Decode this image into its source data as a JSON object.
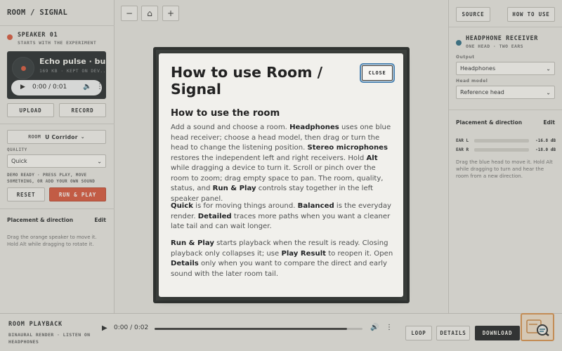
{
  "app_title": "ROOM / SIGNAL",
  "speaker": {
    "title": "SPEAKER 01",
    "subtitle": "STARTS WITH THE EXPERIMENT",
    "sound_name": "Echo pulse · bu...",
    "sound_meta": "169 KB · KEPT ON DEV...",
    "player_time": "0:00 / 0:01",
    "upload_label": "UPLOAD",
    "record_label": "RECORD"
  },
  "room": {
    "label": "ROOM",
    "value": "U Corridor"
  },
  "quality": {
    "label": "QUALITY",
    "value": "Quick"
  },
  "status_text": "DEMO READY · PRESS PLAY, MOVE SOMETHING, OR ADD YOUR OWN SOUND",
  "reset_label": "RESET",
  "run_label": "RUN & PLAY",
  "left_placement": {
    "title": "Placement & direction",
    "edit": "Edit",
    "help": "Drag the orange speaker to move it. Hold Alt while dragging to rotate it."
  },
  "toolbar": {
    "zoom_out": "−",
    "home": "⌂",
    "zoom_in": "+"
  },
  "top_right": {
    "source_label": "SOURCE",
    "howto_label": "HOW TO USE"
  },
  "receiver": {
    "title": "HEADPHONE RECEIVER",
    "subtitle": "ONE HEAD · TWO EARS",
    "output_label": "Output",
    "output_value": "Headphones",
    "head_model_label": "Head model",
    "head_model_value": "Reference head"
  },
  "right_placement": {
    "title": "Placement & direction",
    "edit": "Edit",
    "help": "Drag the blue head to move it. Hold Alt while dragging to turn and hear the room from a new direction."
  },
  "meters": [
    {
      "label": "EAR L",
      "value": "-16.8 dB"
    },
    {
      "label": "EAR R",
      "value": "-18.0 dB"
    }
  ],
  "playback": {
    "title": "ROOM PLAYBACK",
    "subtitle": "BINAURAL RENDER · LISTEN ON HEADPHONES",
    "time": "0:00 / 0:02",
    "loop_label": "LOOP",
    "details_label": "DETAILS",
    "download_label": "DOWNLOAD"
  },
  "modal": {
    "title": "How to use Room / Signal",
    "close_label": "CLOSE",
    "subtitle": "How to use the room",
    "p1": [
      {
        "t": "Add a sound and choose a room. "
      },
      {
        "t": "Headphones",
        "b": true
      },
      {
        "t": " uses one blue head receiver; choose a head model, then drag or turn the head to change the listening position. "
      },
      {
        "t": "Stereo microphones",
        "b": true
      },
      {
        "t": " restores the independent left and right receivers. Hold "
      },
      {
        "t": "Alt",
        "b": true
      },
      {
        "t": " while dragging a device to turn it. Scroll or pinch over the room to zoom; drag empty space to pan. The room, quality, status, and "
      },
      {
        "t": "Run & Play",
        "b": true
      },
      {
        "t": " controls stay together in the left speaker panel."
      }
    ],
    "p2": [
      {
        "t": "Quick",
        "b": true
      },
      {
        "t": " is for moving things around. "
      },
      {
        "t": "Balanced",
        "b": true
      },
      {
        "t": " is the everyday render. "
      },
      {
        "t": "Detailed",
        "b": true
      },
      {
        "t": " traces more paths when you want a cleaner late tail and can wait longer."
      }
    ],
    "p3": [
      {
        "t": "Run & Play",
        "b": true
      },
      {
        "t": " starts playback when the result is ready. Closing playback only collapses it; use "
      },
      {
        "t": "Play Result",
        "b": true
      },
      {
        "t": " to reopen it. Open "
      },
      {
        "t": "Details",
        "b": true
      },
      {
        "t": " only when you want to compare the direct and early sound with the later room tail."
      }
    ]
  },
  "colors": {
    "speaker_accent": "#d8553a",
    "receiver_accent": "#2e6e86",
    "focus_ring": "#4d84b2"
  }
}
